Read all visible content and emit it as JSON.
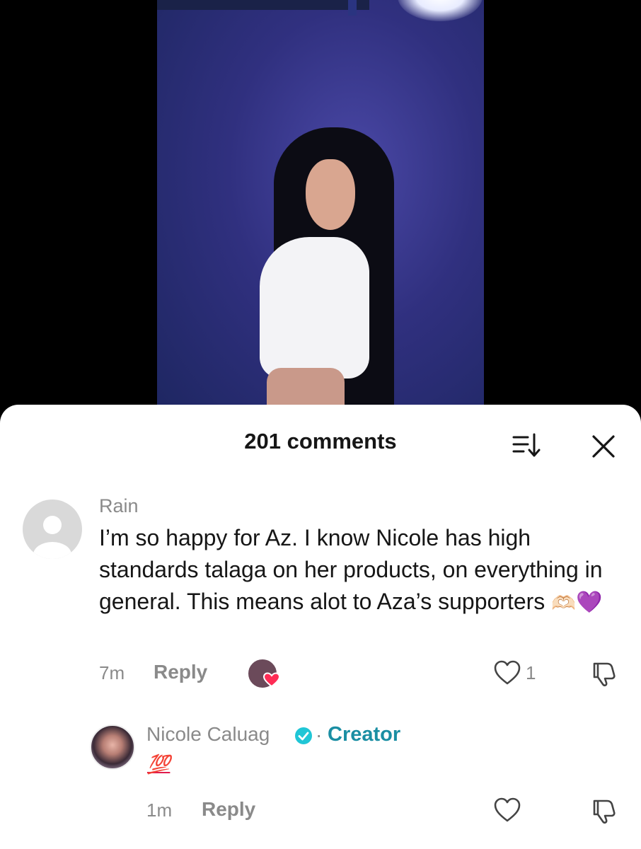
{
  "comments_sheet": {
    "title": "201 comments",
    "sort_icon": "sort-icon",
    "close_icon": "close-icon"
  },
  "comment": {
    "user": "Rain",
    "text": "I’m so happy for Az. I know Nicole has high standards talaga on her products, on everything in general. This means alot to Aza’s supporters",
    "emojis": [
      "🫶🏻",
      "💜"
    ],
    "time": "7m",
    "reply_label": "Reply",
    "like_count": "1",
    "creator_liked": true
  },
  "reply": {
    "user": "Nicole Caluag",
    "separator": "·",
    "badge": "Creator",
    "text": "💯",
    "time": "1m",
    "reply_label": "Reply"
  },
  "colors": {
    "creator_accent": "#1a8ea3",
    "verified": "#20c6d6",
    "secondary_text": "#8a8a8a",
    "emoji_hundred": "#e01b4c"
  }
}
